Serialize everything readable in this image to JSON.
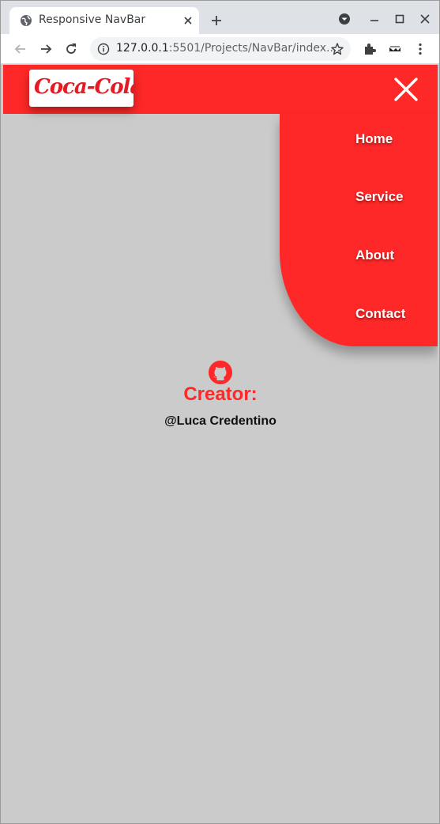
{
  "browser": {
    "tab_title": "Responsive NavBar",
    "url_host": "127.0.0.1",
    "url_rest": ":5501/Projects/NavBar/index...."
  },
  "navbar": {
    "logo_text": "Coca-Cola",
    "menu": [
      "Home",
      "Service",
      "About",
      "Contact"
    ]
  },
  "creator": {
    "label": "Creator:",
    "name": "@Luca Credentino"
  },
  "colors": {
    "accent": "#ff2828",
    "page_background": "#cbcbcb"
  }
}
